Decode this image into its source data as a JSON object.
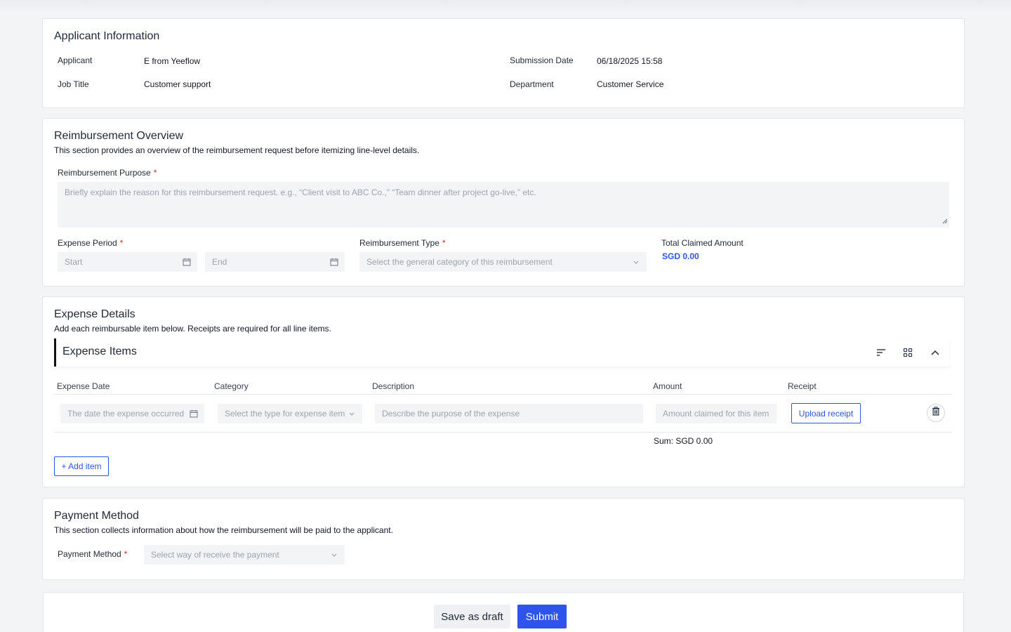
{
  "applicant_info": {
    "title": "Applicant Information",
    "applicant_label": "Applicant",
    "applicant_value": "E from Yeeflow",
    "job_title_label": "Job Title",
    "job_title_value": "Customer support",
    "submission_date_label": "Submission Date",
    "submission_date_value": "06/18/2025 15:58",
    "department_label": "Department",
    "department_value": "Customer Service"
  },
  "overview": {
    "title": "Reimbursement Overview",
    "description": "This section provides an overview of the reimbursement request before itemizing line-level details.",
    "purpose_label": "Reimbursement Purpose",
    "purpose_placeholder": "Briefly explain the reason for this reimbursement request. e.g., “Client visit to ABC Co.,” “Team dinner after project go-live,” etc.",
    "period_label": "Expense Period",
    "start_placeholder": "Start",
    "end_placeholder": "End",
    "type_label": "Reimbursement Type",
    "type_placeholder": "Select the general category of this reimbursement",
    "total_label": "Total Claimed Amount",
    "total_value": "SGD 0.00"
  },
  "expense_details": {
    "title": "Expense Details",
    "description": "Add each reimbursable item below. Receipts are required for all line items.",
    "items_title": "Expense Items",
    "columns": [
      "Expense Date",
      "Category",
      "Description",
      "Amount",
      "Receipt"
    ],
    "row": {
      "date_placeholder": "The date the expense occurred",
      "category_placeholder": "Select the type for expense item",
      "description_placeholder": "Describe the purpose of the expense",
      "amount_placeholder": "Amount claimed for this item",
      "upload_label": "Upload receipt"
    },
    "sum_label": "Sum: SGD 0.00",
    "add_item_label": "+ Add item"
  },
  "payment": {
    "title": "Payment Method",
    "description": "This section collects information about how the reimbursement will be paid to the applicant.",
    "method_label": "Payment Method",
    "method_placeholder": "Select way of receive the payment"
  },
  "actions": {
    "draft_label": "Save as draft",
    "submit_label": "Submit"
  },
  "colors": {
    "primary": "#2f54eb",
    "required": "#e02424",
    "field_bg": "#f3f4f6"
  },
  "icons": [
    "calendar-icon",
    "chevron-down-icon",
    "sort-icon",
    "grid-icon",
    "chevron-up-icon",
    "trash-icon",
    "resize-grip-icon"
  ]
}
